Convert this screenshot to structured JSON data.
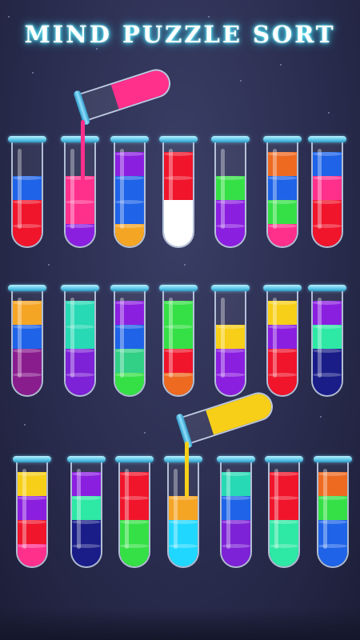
{
  "title": "MIND PUZZLE SORT",
  "colors": {
    "red": "#f0152b",
    "blue": "#1e63e8",
    "pink": "#ff2f8c",
    "violet": "#8b1fe0",
    "purple": "#7d22d6",
    "orange": "#f5a524",
    "white": "#ffffff",
    "green": "#35e046",
    "darkorange": "#ee6a21",
    "teal": "#27d9b4",
    "plum": "#8a1d8e",
    "mint": "#32cf87",
    "yellow": "#f7cf18",
    "navy": "#1a1d88",
    "cyan": "#20d8ff",
    "seafoam": "#2ee8a6"
  },
  "tubes": [
    {
      "row": 0,
      "layers": [
        "red",
        "red",
        "blue"
      ]
    },
    {
      "row": 0,
      "layers": [
        "violet",
        "pink",
        "pink"
      ]
    },
    {
      "row": 0,
      "layers": [
        "orange",
        "blue",
        "blue",
        "violet"
      ]
    },
    {
      "row": 0,
      "layers": [
        "white",
        "white",
        "red",
        "red"
      ]
    },
    {
      "row": 0,
      "layers": [
        "violet",
        "violet",
        "green"
      ]
    },
    {
      "row": 0,
      "layers": [
        "pink",
        "green",
        "blue",
        "darkorange"
      ]
    },
    {
      "row": 0,
      "layers": [
        "red",
        "red",
        "pink",
        "blue"
      ]
    },
    {
      "row": 1,
      "layers": [
        "plum",
        "plum",
        "blue",
        "orange"
      ]
    },
    {
      "row": 1,
      "layers": [
        "purple",
        "purple",
        "teal",
        "teal"
      ]
    },
    {
      "row": 1,
      "layers": [
        "green",
        "mint",
        "blue",
        "violet"
      ]
    },
    {
      "row": 1,
      "layers": [
        "darkorange",
        "red",
        "green",
        "green"
      ]
    },
    {
      "row": 1,
      "layers": [
        "violet",
        "violet",
        "yellow"
      ]
    },
    {
      "row": 1,
      "layers": [
        "red",
        "red",
        "violet",
        "yellow"
      ]
    },
    {
      "row": 1,
      "layers": [
        "navy",
        "navy",
        "seafoam",
        "violet"
      ]
    },
    {
      "row": 2,
      "layers": [
        "pink",
        "red",
        "violet",
        "yellow"
      ]
    },
    {
      "row": 2,
      "layers": [
        "navy",
        "navy",
        "seafoam",
        "violet"
      ]
    },
    {
      "row": 2,
      "layers": [
        "green",
        "green",
        "red",
        "red"
      ]
    },
    {
      "row": 2,
      "layers": [
        "cyan",
        "cyan",
        "orange"
      ]
    },
    {
      "row": 2,
      "layers": [
        "purple",
        "purple",
        "blue",
        "teal"
      ]
    },
    {
      "row": 2,
      "layers": [
        "seafoam",
        "seafoam",
        "red",
        "red"
      ]
    },
    {
      "row": 2,
      "layers": [
        "blue",
        "blue",
        "green",
        "darkorange"
      ]
    }
  ],
  "pouring": [
    {
      "color": "pink",
      "target_tube": 1
    },
    {
      "color": "yellow",
      "target_tube": 17
    }
  ]
}
